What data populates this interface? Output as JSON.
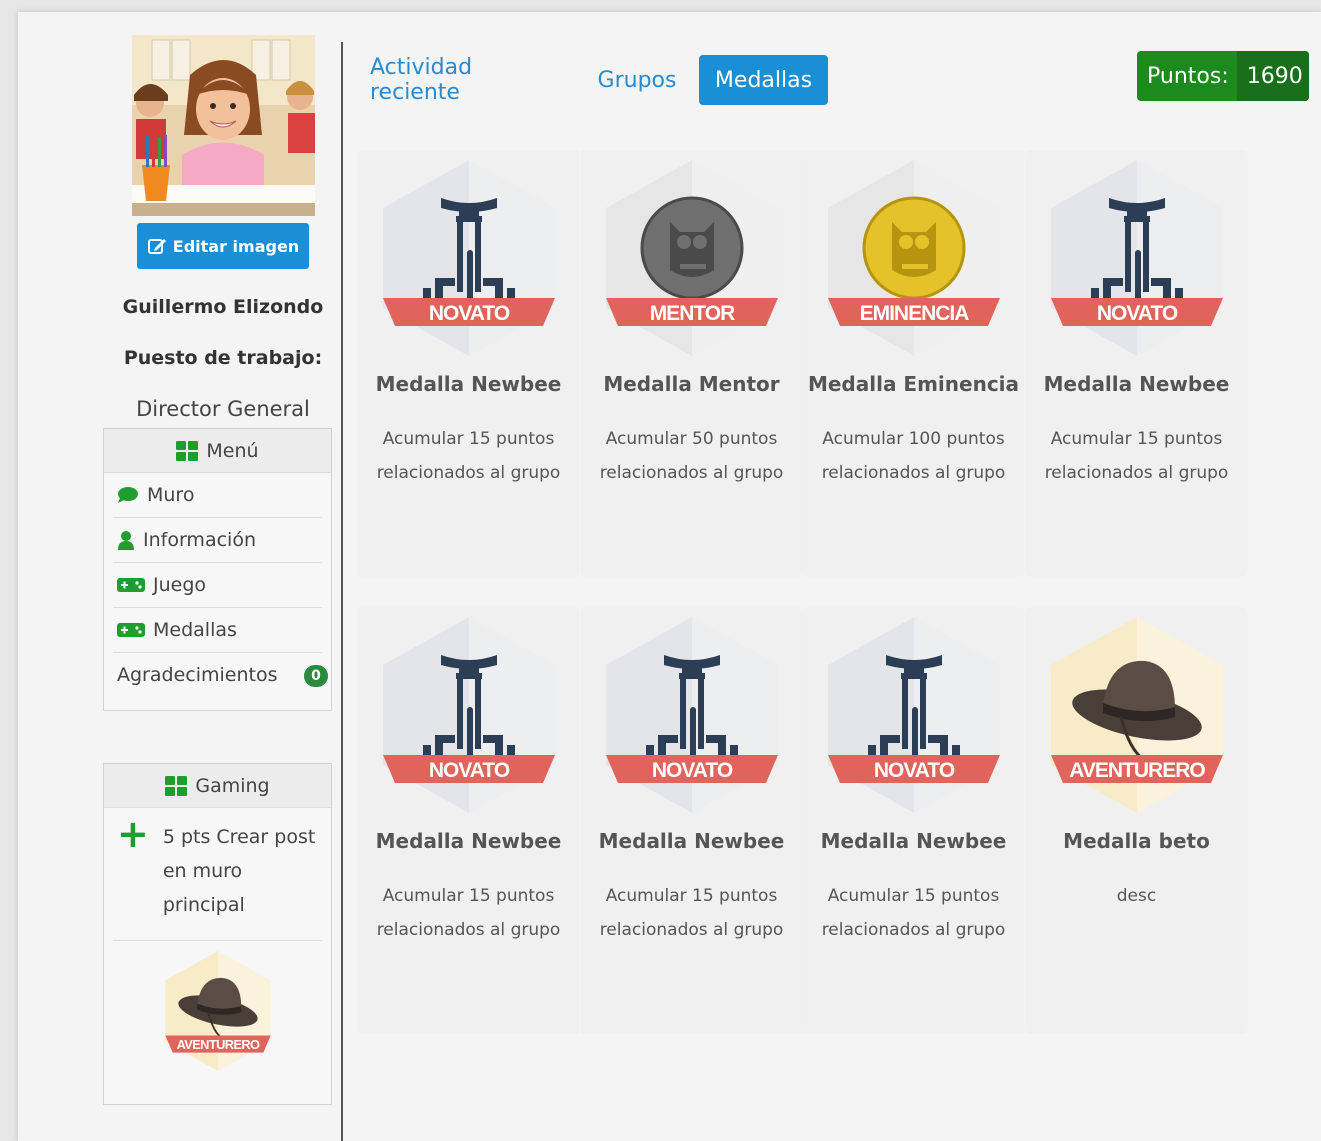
{
  "profile": {
    "edit_image_label": "Editar imagen",
    "name": "Guillermo Elizondo",
    "job_label": "Puesto de trabajo:",
    "job_value": "Director General"
  },
  "menu": {
    "title": "Menú",
    "items": [
      {
        "label": "Muro",
        "icon": "speech-bubble-icon"
      },
      {
        "label": "Información",
        "icon": "user-icon"
      },
      {
        "label": "Juego",
        "icon": "gamepad-icon"
      },
      {
        "label": "Medallas",
        "icon": "gamepad-icon"
      },
      {
        "label": "Agradecimientos",
        "badge": "0"
      }
    ]
  },
  "gaming": {
    "title": "Gaming",
    "item": "5 pts Crear post en muro principal",
    "badge_text": "AVENTURERO"
  },
  "tabs": [
    "Actividad reciente",
    "Grupos",
    "Medallas"
  ],
  "active_tab": "Medallas",
  "points": {
    "label": "Puntos:",
    "value": "1690"
  },
  "medals": [
    {
      "title": "Medalla Newbee",
      "desc": "Acumular 15 puntos relacionados al grupo",
      "banner": "NOVATO",
      "type": "novato"
    },
    {
      "title": "Medalla Mentor",
      "desc": "Acumular 50 puntos relacionados al grupo",
      "banner": "MENTOR",
      "type": "mentor"
    },
    {
      "title": "Medalla Eminencia",
      "desc": "Acumular 100 puntos relacionados al grupo",
      "banner": "EMINENCIA",
      "type": "eminencia"
    },
    {
      "title": "Medalla Newbee",
      "desc": "Acumular 15 puntos relacionados al grupo",
      "banner": "NOVATO",
      "type": "novato"
    },
    {
      "title": "Medalla Newbee",
      "desc": "Acumular 15 puntos relacionados al grupo",
      "banner": "NOVATO",
      "type": "novato"
    },
    {
      "title": "Medalla Newbee",
      "desc": "Acumular 15 puntos relacionados al grupo",
      "banner": "NOVATO",
      "type": "novato"
    },
    {
      "title": "Medalla Newbee",
      "desc": "Acumular 15 puntos relacionados al grupo",
      "banner": "NOVATO",
      "type": "novato"
    },
    {
      "title": "Medalla beto",
      "desc": "desc",
      "banner": "AVENTURERO",
      "type": "aventurero"
    }
  ]
}
